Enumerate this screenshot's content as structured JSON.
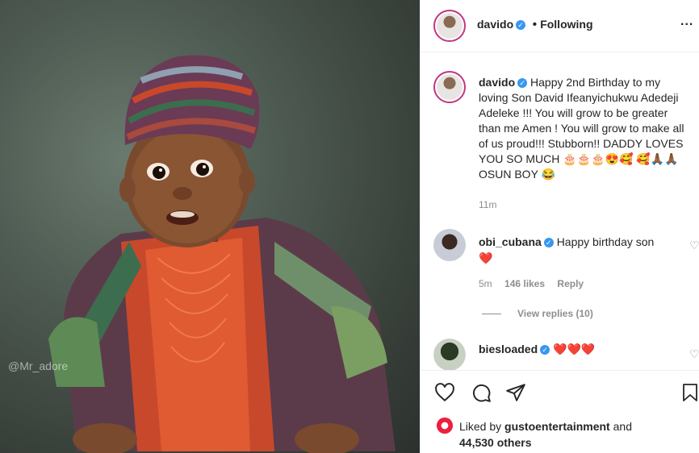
{
  "photo": {
    "watermark": "@Mr_adore"
  },
  "header": {
    "username": "davido",
    "separator": "•",
    "following": "Following",
    "more": "..."
  },
  "caption": {
    "username": "davido",
    "text": "Happy 2nd Birthday to my loving Son David Ifeanyichukwu Adedeji Adeleke !!! You will grow to be greater than me Amen ! You will grow to make all of us proud!!! Stubborn!! DADDY LOVES YOU SO MUCH 🎂🎂🎂😍🥰 🥰🙏🏾🙏🏾 OSUN BOY 😂",
    "time": "11m"
  },
  "comments": [
    {
      "username": "obi_cubana",
      "text": "Happy birthday son",
      "emoji": "❤️",
      "time": "5m",
      "likes": "146 likes",
      "reply": "Reply",
      "view_replies": "View replies (10)"
    },
    {
      "username": "biesloaded",
      "text": "❤️❤️❤️"
    }
  ],
  "footer": {
    "liked_by_prefix": "Liked by",
    "liked_by_user": "gustoentertainment",
    "liked_by_and": "and",
    "others": "44,530 others"
  },
  "colors": {
    "accent": "#3897f0",
    "heart": "#ed1f3f",
    "ring": "#c13584"
  }
}
